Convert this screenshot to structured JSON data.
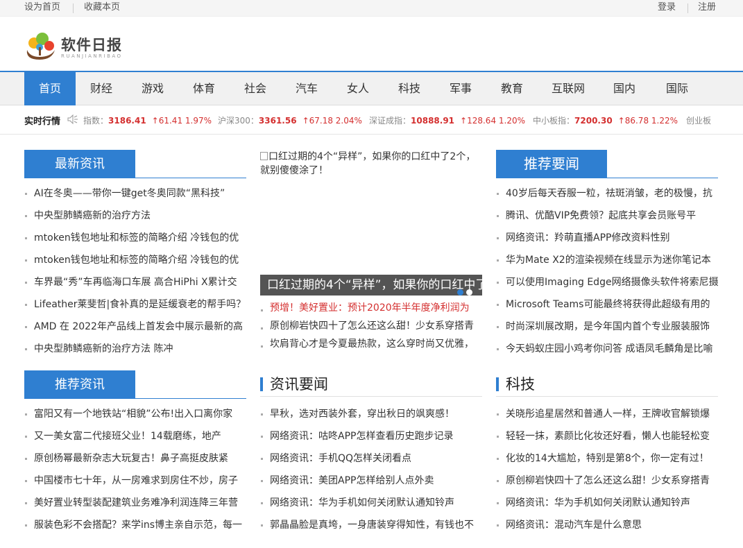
{
  "topbar": {
    "set_home": "设为首页",
    "bookmark": "收藏本页",
    "login": "登录",
    "register": "注册"
  },
  "logo": {
    "cn": "软件日报",
    "en": "RUANJIANRIBAO"
  },
  "nav": [
    "首页",
    "财经",
    "游戏",
    "体育",
    "社会",
    "汽车",
    "女人",
    "科技",
    "军事",
    "教育",
    "互联网",
    "国内",
    "国际"
  ],
  "ticker": {
    "title": "实时行情",
    "items": [
      {
        "label": "指数：",
        "value": "3186.41",
        "change": "↑61.41 1.97%"
      },
      {
        "label": "沪深300：",
        "value": "3361.56",
        "change": "↑67.18 2.04%"
      },
      {
        "label": "深证成指：",
        "value": "10888.91",
        "change": "↑128.64 1.20%"
      },
      {
        "label": "中小板指：",
        "value": "7200.30",
        "change": "↑86.78 1.22%"
      },
      {
        "label": "创业板",
        "value": "",
        "change": ""
      }
    ]
  },
  "latest": {
    "title": "最新资讯",
    "items": [
      "AI在冬奥——带你一键get冬奥同款“黑科技”",
      "中央型肺鳞癌新的治疗方法",
      "mtoken钱包地址和标签的简略介绍 冷钱包的优",
      "mtoken钱包地址和标签的简略介绍 冷钱包的优",
      "车界最“秀”车再临海口车展 高合HiPhi X累计交",
      "Lifeather莱斐哲|食补真的是延缓衰老的帮手吗？",
      "AMD 在 2022年产品线上首发会中展示最新的高",
      "中央型肺鳞癌新的治疗方法 陈冲"
    ]
  },
  "recommend": {
    "title": "推荐资讯",
    "items": [
      "富阳又有一个地铁站“相貌”公布!出入口离你家",
      "又一美女富二代接班父业！14载磨练，地产",
      "原创杨幂最新杂志大玩复古！鼻子高挺皮肤紧",
      "中国楼市七十年，从一房难求到房住不炒，房子",
      "美好置业转型装配建筑业务难净利润连降三年营",
      "服装色彩不会搭配？来学ins博主亲自示范，每一"
    ]
  },
  "featured": {
    "alt": "口红过期的4个“异样”，如果你的口红中了2个，就别傻傻涂了！",
    "caption": "口红过期的4个“异样”，如果你的口红中了2个，就别傻傻涂了！",
    "items": [
      "预增！美好置业：预计2020年半年度净利润为",
      "原创柳岩快四十了怎么还这么甜！少女系穿搭青",
      "坎肩背心才是今夏最热款，这么穿时尚又优雅，"
    ]
  },
  "news": {
    "title": "资讯要闻",
    "items": [
      "早秋，选对西装外套，穿出秋日的飒爽感！",
      "网络资讯：咕咚APP怎样查看历史跑步记录",
      "网络资讯：手机QQ怎样关闭看点",
      "网络资讯：美团APP怎样给别人点外卖",
      "网络资讯：华为手机如何关闭默认通知铃声",
      "郭晶晶脸是真垮，一身唐装穿得知性，有钱也不"
    ]
  },
  "top_news": {
    "title": "推荐要闻",
    "items": [
      "40岁后每天吞服一粒，祛斑消皱，老的极慢，抗",
      "腾讯、优酷VIP免费领？起底共享会员账号平",
      "网络资讯：羚萌直播APP修改资料性别",
      "华为Mate X2的渲染视频在线显示为迷你笔记本",
      "可以使用Imaging Edge网络摄像头软件将索尼摄",
      "Microsoft Teams可能最终将获得此超级有用的",
      "时尚深圳展改期，是今年国内首个专业服装服饰",
      "今天蚂蚁庄园小鸡考你问答 成语凤毛麟角是比喻"
    ]
  },
  "tech": {
    "title": "科技",
    "items": [
      "关晓彤追星居然和普通人一样，王牌收官解锁爆",
      "轻轻一抹，素颜比化妆还好看，懒人也能轻松变",
      "化妆的14大尴尬，特别是第8个，你一定有过！",
      "原创柳岩快四十了怎么还这么甜！少女系穿搭青",
      "网络资讯：华为手机如何关闭默认通知铃声",
      "网络资讯：混动汽车是什么意思"
    ]
  },
  "colors": {
    "accent": "#2f7fd1",
    "highlight": "#d42f2f"
  }
}
